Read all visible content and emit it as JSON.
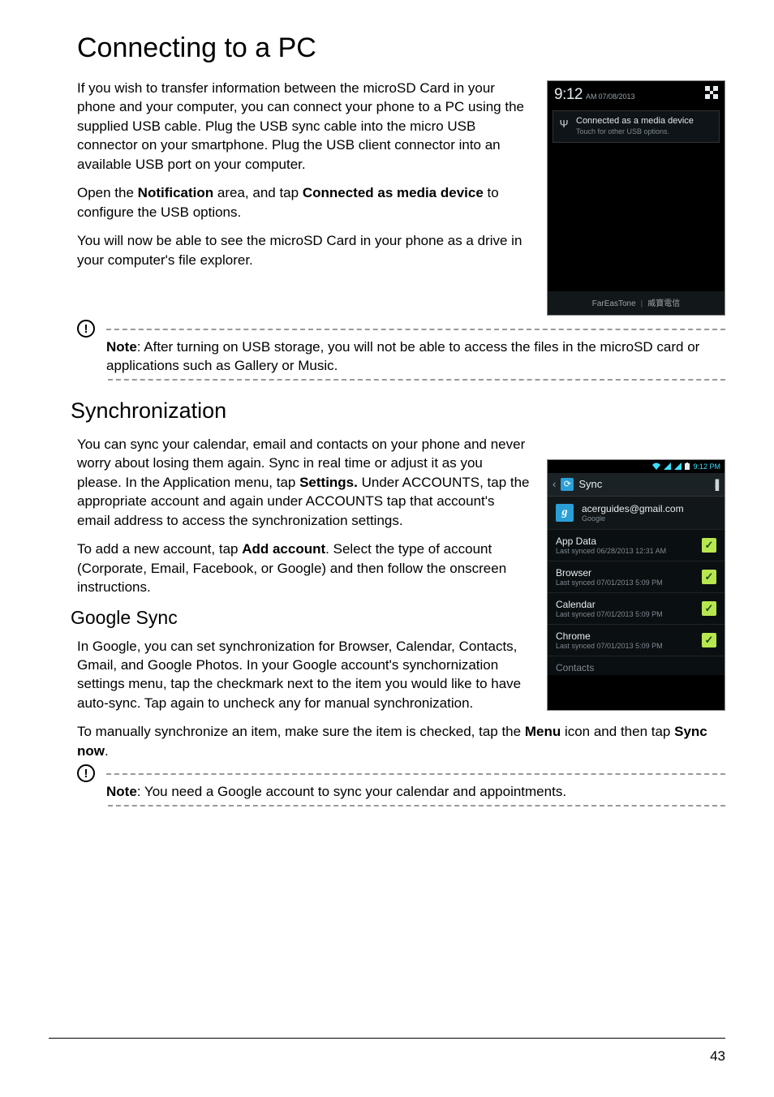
{
  "title": "Connecting to a PC",
  "p1": "If you wish to transfer information between the microSD Card in your phone and your computer, you can connect your phone to a PC using the supplied USB cable. Plug the USB sync cable into the micro USB connector on your smartphone. Plug the USB client connector into an available USB port on your computer.",
  "p2_a": "Open the ",
  "p2_b": "Notification",
  "p2_c": " area, and tap ",
  "p2_d": "Connected as media device",
  "p2_e": " to configure the USB options.",
  "p3": "You will now be able to see the microSD Card in your phone as a drive in your computer's file explorer.",
  "note1_label": "Note",
  "note1_text": ": After turning on USB storage, you will not be able to access the files in the microSD card or applications such as Gallery or Music.",
  "sync_heading": "Synchronization",
  "p4_a": "You can sync your calendar, email and contacts on your phone and never worry about losing them again. Sync in real time or adjust it as you please. In the Application menu, tap ",
  "p4_b": "Settings.",
  "p4_c": " Under ACCOUNTS, tap the appropriate account and again under ACCOUNTS tap that account's email address to access the synchronization settings.",
  "p5_a": "To add a new account, tap ",
  "p5_b": "Add account",
  "p5_c": ". Select the type of account (Corporate, Email, Facebook, or Google) and then follow the onscreen instructions.",
  "gsync_heading": "Google Sync",
  "p6": "In Google, you can set synchronization for Browser, Calendar, Contacts, Gmail, and Google Photos. In your Google account's synchornization settings menu, tap the checkmark next to the item you would like to have auto-sync. Tap again to uncheck any for manual synchronization.",
  "p7_a": "To manually synchronize an item, make sure the item is checked, tap the ",
  "p7_b": "Menu",
  "p7_c": " icon and then tap ",
  "p7_d": "Sync now",
  "p7_e": ".",
  "note2_label": "Note",
  "note2_text": ": You need a Google account to sync your calendar and appointments.",
  "page_number": "43",
  "phone1": {
    "time": "9:12",
    "ampm": " AM",
    "date": "07/08/2013",
    "notif_title": "Connected as a media device",
    "notif_sub": "Touch for other USB options.",
    "carrier_left": "FarEasTone",
    "carrier_right": "威寶電信"
  },
  "phone2": {
    "status_time": "9:12 PM",
    "header": "Sync",
    "email": "acerguides@gmail.com",
    "provider": "Google",
    "items": [
      {
        "name": "App Data",
        "sub": "Last synced 06/28/2013 12:31 AM"
      },
      {
        "name": "Browser",
        "sub": "Last synced 07/01/2013 5:09 PM"
      },
      {
        "name": "Calendar",
        "sub": "Last synced 07/01/2013 5:09 PM"
      },
      {
        "name": "Chrome",
        "sub": "Last synced 07/01/2013 5:09 PM"
      }
    ],
    "partial_item": "Contacts"
  },
  "chart_data": {
    "type": "table",
    "note": "document page; no chart"
  }
}
